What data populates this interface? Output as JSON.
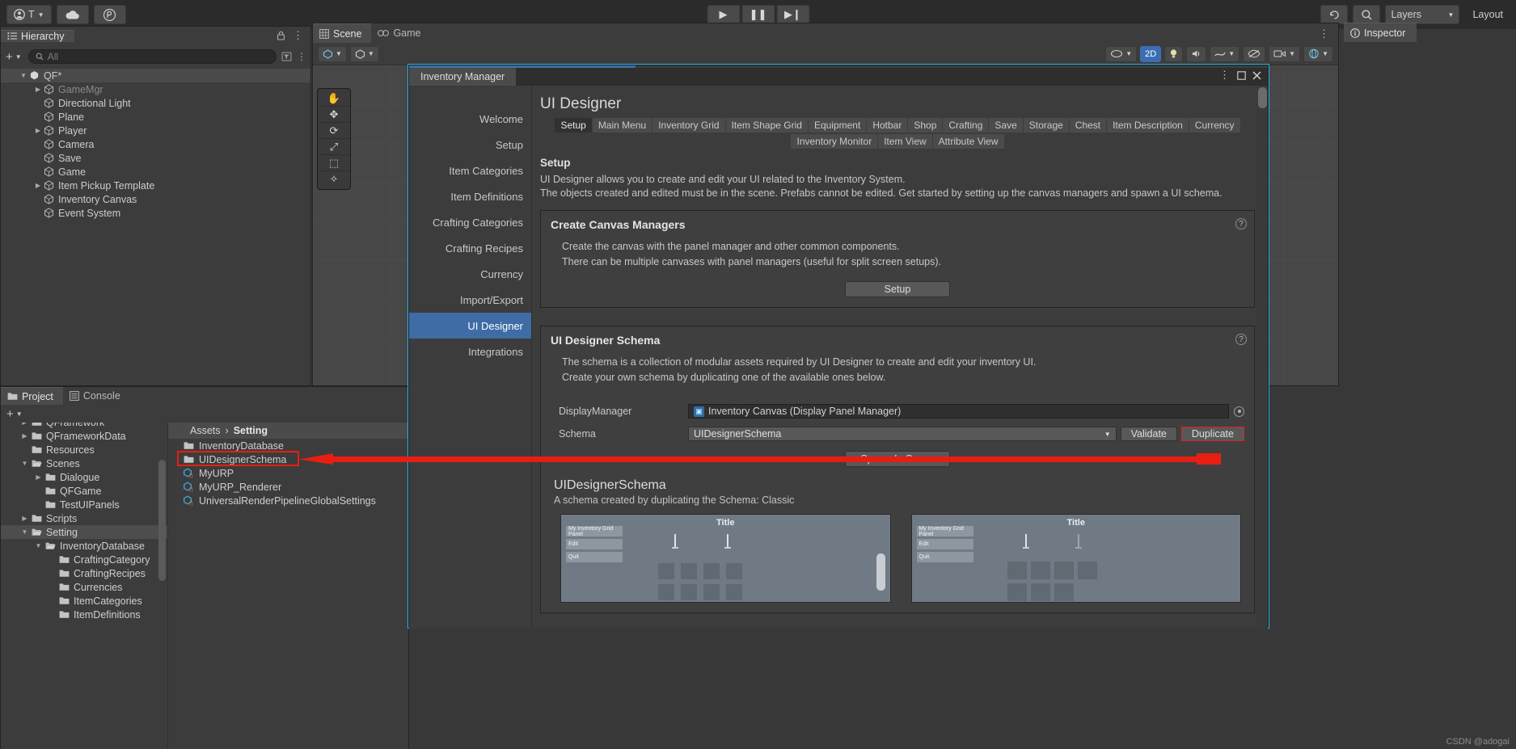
{
  "toolbar": {
    "account_label": "T",
    "cloud_icon": "cloud-icon",
    "collab_icon": "collab-icon",
    "play": "▶",
    "pause": "❚❚",
    "step": "▶❙",
    "history_icon": "undo-history-icon",
    "search_icon": "search-icon",
    "layers_label": "Layers",
    "layout_label": "Layout"
  },
  "hierarchy": {
    "tab_label": "Hierarchy",
    "lock_icon": "lock-icon",
    "menu_icon": "kebab-menu-icon",
    "add_label": "+",
    "search_placeholder": "All",
    "items": [
      {
        "label": "QF*",
        "depth": 0,
        "arrow": "▼",
        "selected": true,
        "dim": false,
        "icon": "unity-scene-icon"
      },
      {
        "label": "GameMgr",
        "depth": 1,
        "arrow": "▶",
        "selected": false,
        "dim": true,
        "icon": "gameobject-icon"
      },
      {
        "label": "Directional Light",
        "depth": 1,
        "arrow": "",
        "selected": false,
        "dim": false,
        "icon": "gameobject-icon"
      },
      {
        "label": "Plane",
        "depth": 1,
        "arrow": "",
        "selected": false,
        "dim": false,
        "icon": "gameobject-icon"
      },
      {
        "label": "Player",
        "depth": 1,
        "arrow": "▶",
        "selected": false,
        "dim": false,
        "icon": "gameobject-icon"
      },
      {
        "label": "Camera",
        "depth": 1,
        "arrow": "",
        "selected": false,
        "dim": false,
        "icon": "gameobject-icon"
      },
      {
        "label": "Save",
        "depth": 1,
        "arrow": "",
        "selected": false,
        "dim": false,
        "icon": "gameobject-icon"
      },
      {
        "label": "Game",
        "depth": 1,
        "arrow": "",
        "selected": false,
        "dim": false,
        "icon": "gameobject-icon"
      },
      {
        "label": "Item Pickup Template",
        "depth": 1,
        "arrow": "▶",
        "selected": false,
        "dim": false,
        "icon": "gameobject-icon"
      },
      {
        "label": "Inventory Canvas",
        "depth": 1,
        "arrow": "",
        "selected": false,
        "dim": false,
        "icon": "gameobject-icon"
      },
      {
        "label": "Event System",
        "depth": 1,
        "arrow": "",
        "selected": false,
        "dim": false,
        "icon": "gameobject-icon"
      }
    ]
  },
  "scene": {
    "tabs": [
      {
        "label": "Scene",
        "active": true,
        "icon": "scene-grid-icon"
      },
      {
        "label": "Game",
        "active": false,
        "icon": "game-display-icon"
      }
    ],
    "menu_icon": "kebab-menu-icon",
    "tools": [
      {
        "name": "shading-mode",
        "label": "",
        "on": false
      },
      {
        "name": "2d-toggle",
        "label": "2D",
        "on": true
      },
      {
        "name": "lighting-toggle",
        "label": "",
        "on": false
      },
      {
        "name": "audio-toggle",
        "label": "",
        "on": false
      },
      {
        "name": "fx-toggle",
        "label": "",
        "on": false
      },
      {
        "name": "hidden-toggle",
        "label": "",
        "on": false
      },
      {
        "name": "camera-toggle",
        "label": "",
        "on": false
      },
      {
        "name": "gizmos-toggle",
        "label": "",
        "on": false
      }
    ],
    "left_tools": [
      {
        "name": "hand-tool",
        "glyph": "✋",
        "on": false
      },
      {
        "name": "move-tool",
        "glyph": "✥",
        "on": false
      },
      {
        "name": "rotate-tool",
        "glyph": "⟳",
        "on": false
      },
      {
        "name": "scale-tool",
        "glyph": "⤢",
        "on": false
      },
      {
        "name": "rect-tool",
        "glyph": "⬚",
        "on": false
      },
      {
        "name": "transform-tool",
        "glyph": "✧",
        "on": false
      }
    ]
  },
  "inspector": {
    "tab_label": "Inspector",
    "icon": "info-icon"
  },
  "project": {
    "tabs": [
      {
        "label": "Project",
        "active": true,
        "icon": "folder-icon"
      },
      {
        "label": "Console",
        "active": false,
        "icon": "console-icon"
      }
    ],
    "add_label": "+",
    "tree": [
      {
        "label": "QFramework",
        "depth": 1,
        "arrow": "▶",
        "selected": false,
        "open": false
      },
      {
        "label": "QFrameworkData",
        "depth": 1,
        "arrow": "▶",
        "selected": false,
        "open": false
      },
      {
        "label": "Resources",
        "depth": 1,
        "arrow": "",
        "selected": false,
        "open": false
      },
      {
        "label": "Scenes",
        "depth": 1,
        "arrow": "▼",
        "selected": false,
        "open": true
      },
      {
        "label": "Dialogue",
        "depth": 2,
        "arrow": "▶",
        "selected": false,
        "open": false
      },
      {
        "label": "QFGame",
        "depth": 2,
        "arrow": "",
        "selected": false,
        "open": false
      },
      {
        "label": "TestUIPanels",
        "depth": 2,
        "arrow": "",
        "selected": false,
        "open": false
      },
      {
        "label": "Scripts",
        "depth": 1,
        "arrow": "▶",
        "selected": false,
        "open": false
      },
      {
        "label": "Setting",
        "depth": 1,
        "arrow": "▼",
        "selected": true,
        "open": true
      },
      {
        "label": "InventoryDatabase",
        "depth": 2,
        "arrow": "▼",
        "selected": false,
        "open": true
      },
      {
        "label": "CraftingCategory",
        "depth": 3,
        "arrow": "",
        "selected": false,
        "open": false
      },
      {
        "label": "CraftingRecipes",
        "depth": 3,
        "arrow": "",
        "selected": false,
        "open": false
      },
      {
        "label": "Currencies",
        "depth": 3,
        "arrow": "",
        "selected": false,
        "open": false
      },
      {
        "label": "ItemCategories",
        "depth": 3,
        "arrow": "",
        "selected": false,
        "open": false
      },
      {
        "label": "ItemDefinitions",
        "depth": 3,
        "arrow": "",
        "selected": false,
        "open": false
      }
    ],
    "breadcrumb": [
      "Assets",
      "Setting"
    ],
    "files": [
      {
        "label": "InventoryDatabase",
        "type": "folder",
        "highlighted": false
      },
      {
        "label": "UIDesignerSchema",
        "type": "folder",
        "highlighted": true
      },
      {
        "label": "MyURP",
        "type": "asset",
        "highlighted": false
      },
      {
        "label": "MyURP_Renderer",
        "type": "asset",
        "highlighted": false
      },
      {
        "label": "UniversalRenderPipelineGlobalSettings",
        "type": "asset",
        "highlighted": false
      }
    ]
  },
  "inventory_manager": {
    "window_tab": "Inventory Manager",
    "window_menu_icon": "kebab-menu-icon",
    "window_maximize_icon": "maximize-icon",
    "window_close_icon": "close-icon",
    "nav": [
      {
        "label": "Welcome",
        "active": false
      },
      {
        "label": "Setup",
        "active": false
      },
      {
        "label": "Item Categories",
        "active": false
      },
      {
        "label": "Item Definitions",
        "active": false
      },
      {
        "label": "Crafting Categories",
        "active": false
      },
      {
        "label": "Crafting Recipes",
        "active": false
      },
      {
        "label": "Currency",
        "active": false
      },
      {
        "label": "Import/Export",
        "active": false
      },
      {
        "label": "UI Designer",
        "active": true
      },
      {
        "label": "Integrations",
        "active": false
      }
    ],
    "title": "UI Designer",
    "tabs_row1": [
      {
        "label": "Setup",
        "on": true
      },
      {
        "label": "Main Menu",
        "on": false
      },
      {
        "label": "Inventory Grid",
        "on": false
      },
      {
        "label": "Item Shape Grid",
        "on": false
      },
      {
        "label": "Equipment",
        "on": false
      },
      {
        "label": "Hotbar",
        "on": false
      },
      {
        "label": "Shop",
        "on": false
      },
      {
        "label": "Crafting",
        "on": false
      },
      {
        "label": "Save",
        "on": false
      },
      {
        "label": "Storage",
        "on": false
      },
      {
        "label": "Chest",
        "on": false
      },
      {
        "label": "Item Description",
        "on": false
      },
      {
        "label": "Currency",
        "on": false
      }
    ],
    "tabs_row2": [
      {
        "label": "Inventory Monitor",
        "on": false
      },
      {
        "label": "Item View",
        "on": false
      },
      {
        "label": "Attribute View",
        "on": false
      }
    ],
    "setup_heading": "Setup",
    "setup_paragraph_1": "UI Designer allows you to create and edit your UI related to the Inventory System.",
    "setup_paragraph_2": "The objects created and edited must be in the scene. Prefabs cannot be edited. Get started by setting up the canvas managers and spawn a UI schema.",
    "canvas_box": {
      "title": "Create Canvas Managers",
      "line1": "Create the canvas with the panel manager and other common components.",
      "line2": "There can be multiple canvases with panel managers (useful for split screen setups).",
      "button": "Setup",
      "help_icon": "help-icon"
    },
    "schema_box": {
      "title": "UI Designer Schema",
      "line1": "The schema is a collection of modular assets required by UI Designer to create and edit your inventory UI.",
      "line2": "Create your own schema by duplicating one of the available ones below.",
      "help_icon": "help-icon",
      "display_manager_label": "DisplayManager",
      "display_manager_value": "Inventory Canvas (Display Panel Manager)",
      "schema_label": "Schema",
      "schema_value": "UIDesignerSchema",
      "validate_button": "Validate",
      "duplicate_button": "Duplicate",
      "spawn_button": "Spawn In Scene"
    },
    "schema_detail": {
      "title": "UIDesignerSchema",
      "subtitle": "A schema created by duplicating the Schema: Classic",
      "preview_title": "Title",
      "preview_panel_label": "My Inventory Grid Panel",
      "preview_rows": [
        "Edit",
        "Quit"
      ]
    }
  },
  "watermark": "CSDN @adogai",
  "colors": {
    "accent_blue": "#3f6ca5",
    "highlight_red": "#e81e12",
    "window_border_cyan": "#29b7e8"
  }
}
